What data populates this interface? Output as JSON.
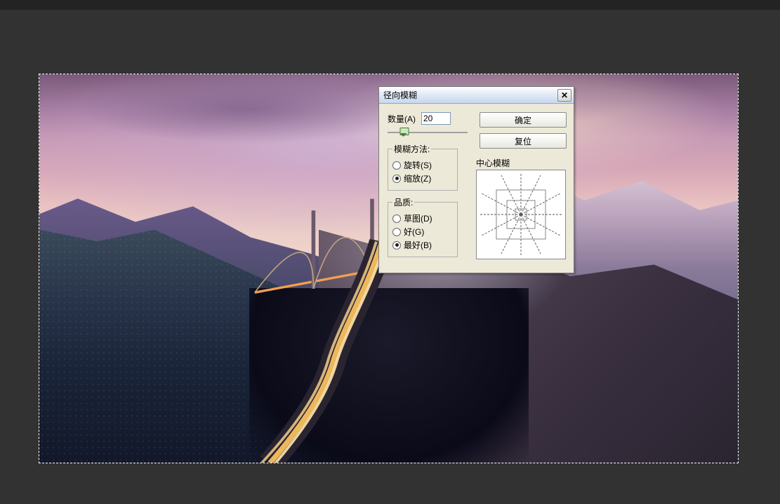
{
  "dialog": {
    "title": "径向模糊",
    "amount_label": "数量(A)",
    "amount_value": "20",
    "slider_percent": 20,
    "buttons": {
      "ok": "确定",
      "reset": "复位"
    },
    "method": {
      "legend": "模糊方法:",
      "options": [
        {
          "label": "旋转(S)",
          "checked": false
        },
        {
          "label": "缩放(Z)",
          "checked": true
        }
      ]
    },
    "quality": {
      "legend": "品质:",
      "options": [
        {
          "label": "草图(D)",
          "checked": false
        },
        {
          "label": "好(G)",
          "checked": false
        },
        {
          "label": "最好(B)",
          "checked": true
        }
      ]
    },
    "center_label": "中心模糊"
  }
}
